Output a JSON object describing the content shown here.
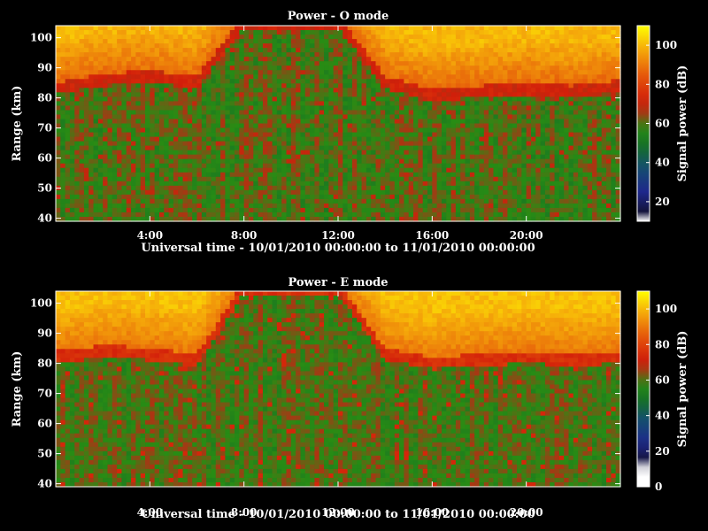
{
  "chart_data": [
    {
      "type": "heatmap",
      "title": "Power - O mode",
      "xlabel": "Universal time - 10/01/2010 00:00:00 to 11/01/2010 00:00:00",
      "ylabel": "Range (km)",
      "xlim": [
        0,
        24
      ],
      "ylim": [
        39,
        104
      ],
      "xticks": [
        4,
        8,
        12,
        16,
        20
      ],
      "xtick_labels": [
        "4:00",
        "8:00",
        "12:00",
        "16:00",
        "20:00"
      ],
      "yticks": [
        40,
        50,
        60,
        70,
        80,
        90,
        100
      ],
      "ytick_labels": [
        "40",
        "50",
        "60",
        "70",
        "80",
        "90",
        "100"
      ],
      "colorbar": {
        "label": "Signal power (dB)",
        "range": [
          10,
          110
        ],
        "ticks": [
          20,
          40,
          60,
          80,
          100
        ],
        "tick_labels": [
          "20",
          "40",
          "60",
          "80",
          "100"
        ]
      },
      "description_of_field": {
        "upper_layer_power_db_range": [
          85,
          100
        ],
        "lower_layer_power_db_range": [
          55,
          65
        ],
        "transition_height_km": {
          "hours": [
            0,
            2,
            4,
            6,
            8,
            10,
            12,
            14,
            16,
            18,
            20,
            22,
            24
          ],
          "km": [
            82,
            85,
            86,
            84,
            104,
            104,
            104,
            84,
            80,
            81,
            82,
            81,
            83
          ]
        }
      }
    },
    {
      "type": "heatmap",
      "title": "Power - E mode",
      "xlabel": "Universal time - 10/01/2010 00:00:00 to 11/01/2010 00:00:00",
      "ylabel": "Range (km)",
      "xlim": [
        0,
        24
      ],
      "ylim": [
        39,
        104
      ],
      "xticks": [
        4,
        8,
        12,
        16,
        20
      ],
      "xtick_labels": [
        "4:00",
        "8:00",
        "12:00",
        "16:00",
        "20:00"
      ],
      "yticks": [
        40,
        50,
        60,
        70,
        80,
        90,
        100
      ],
      "ytick_labels": [
        "40",
        "50",
        "60",
        "70",
        "80",
        "90",
        "100"
      ],
      "colorbar": {
        "label": "Signal power (dB)",
        "range": [
          0,
          110
        ],
        "ticks": [
          0,
          20,
          40,
          60,
          80,
          100
        ],
        "tick_labels": [
          "0",
          "20",
          "40",
          "60",
          "80",
          "100"
        ]
      },
      "description_of_field": {
        "upper_layer_power_db_range": [
          85,
          100
        ],
        "lower_layer_power_db_range": [
          50,
          60
        ],
        "transition_height_km": {
          "hours": [
            0,
            2,
            4,
            6,
            8,
            10,
            12,
            14,
            16,
            18,
            20,
            22,
            24
          ],
          "km": [
            81,
            83,
            82,
            80,
            104,
            104,
            104,
            82,
            79,
            80,
            81,
            80,
            81
          ]
        }
      }
    }
  ]
}
